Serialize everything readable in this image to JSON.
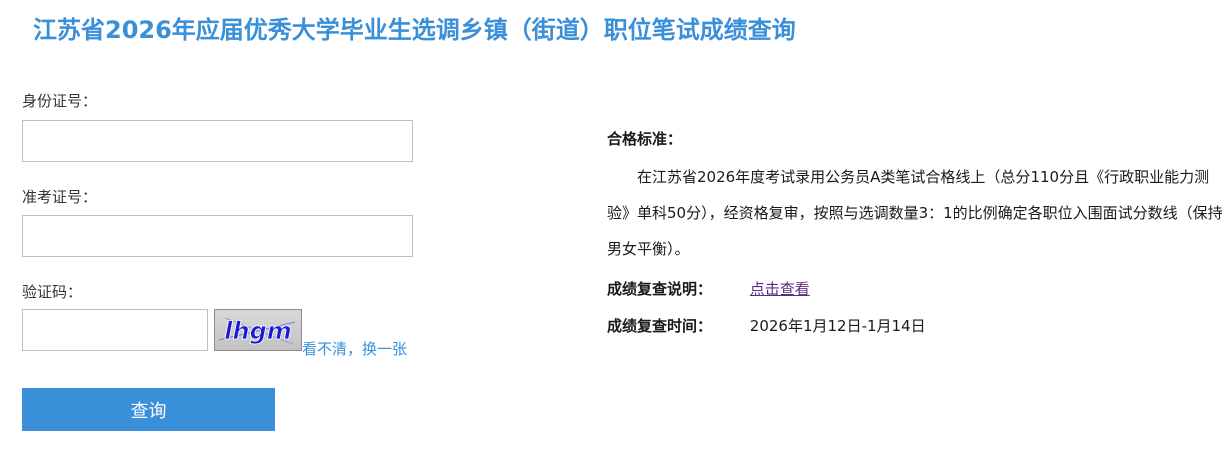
{
  "header": {
    "title": "江苏省2026年应届优秀大学毕业生选调乡镇（街道）职位笔试成绩查询"
  },
  "form": {
    "id_label": "身份证号：",
    "id_value": "",
    "exam_label": "准考证号：",
    "exam_value": "",
    "captcha_label": "验证码：",
    "captcha_value": "",
    "captcha_text": "lhgm",
    "captcha_refresh": "看不清，换一张",
    "submit_label": "查询"
  },
  "info": {
    "standard_heading": "合格标准：",
    "standard_text": "在江苏省2026年度考试录用公务员A类笔试合格线上（总分110分且《行政职业能力测验》单科50分），经资格复审，按照与选调数量3：1的比例确定各职位入围面试分数线（保持男女平衡）。",
    "review_label": "成绩复查说明：",
    "review_link": "点击查看",
    "review_time_label": "成绩复查时间：",
    "review_time_value": "2026年1月12日-1月14日"
  },
  "colors": {
    "accent": "#3a8fd9",
    "link_visited": "#5a2d82",
    "captcha_text": "#1a1ad6"
  }
}
